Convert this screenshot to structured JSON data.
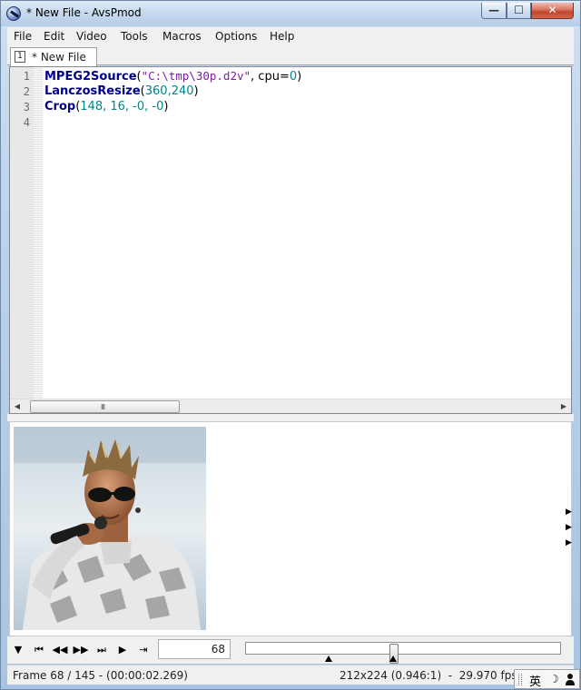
{
  "window": {
    "title": "* New File - AvsPmod"
  },
  "window_controls": {
    "minimize": "—",
    "maximize": "☐",
    "close": "✕"
  },
  "menu": [
    "File",
    "Edit",
    "Video",
    "Tools",
    "Macros",
    "Options",
    "Help"
  ],
  "tabs": [
    {
      "number": "1",
      "label": "* New File"
    }
  ],
  "editor": {
    "line_numbers": [
      "1",
      "2",
      "3",
      "4"
    ],
    "lines": [
      {
        "fn": "MPEG2Source",
        "open": "(",
        "str": "\"C:\\tmp\\30p.d2v\"",
        "sep": ", cpu=",
        "num": "0",
        "close": ")"
      },
      {
        "fn": "LanczosResize",
        "open": "(",
        "args": "360,240",
        "close": ")"
      },
      {
        "fn": "Crop",
        "open": "(",
        "args": "148, 16, -0, -0",
        "close": ")"
      }
    ],
    "scroll_grip": "III"
  },
  "playback": {
    "frame_value": "68",
    "controls": [
      "play-dropdown",
      "first-frame",
      "prev-frame",
      "next-frame",
      "last-frame",
      "play",
      "goto-position"
    ]
  },
  "slider": {
    "position_fraction": 0.469,
    "bookmarks_fraction": [
      0.265,
      0.469
    ]
  },
  "status": {
    "left": "Frame 68 / 145  -  (00:00:02.269)",
    "right": "212x224 (0.946:1)  -  29.970 fps"
  },
  "ime": {
    "char": "英",
    "moon": "☽"
  }
}
